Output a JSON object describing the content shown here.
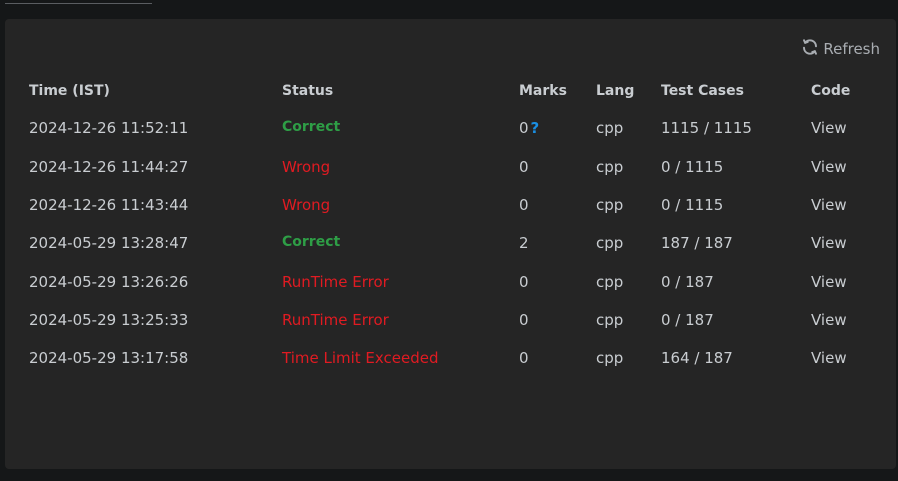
{
  "refresh_label": "Refresh",
  "headers": {
    "time": "Time (IST)",
    "status": "Status",
    "marks": "Marks",
    "lang": "Lang",
    "test_cases": "Test Cases",
    "code": "Code"
  },
  "rows": [
    {
      "time": "2024-12-26 11:52:11",
      "status": "Correct",
      "status_type": "correct",
      "marks": "0",
      "has_help": true,
      "lang": "cpp",
      "test_cases": "1115 / 1115",
      "code": "View"
    },
    {
      "time": "2024-12-26 11:44:27",
      "status": "Wrong",
      "status_type": "wrong",
      "marks": "0",
      "has_help": false,
      "lang": "cpp",
      "test_cases": "0 / 1115",
      "code": "View"
    },
    {
      "time": "2024-12-26 11:43:44",
      "status": "Wrong",
      "status_type": "wrong",
      "marks": "0",
      "has_help": false,
      "lang": "cpp",
      "test_cases": "0 / 1115",
      "code": "View"
    },
    {
      "time": "2024-05-29 13:28:47",
      "status": "Correct",
      "status_type": "correct",
      "marks": "2",
      "has_help": false,
      "lang": "cpp",
      "test_cases": "187 / 187",
      "code": "View"
    },
    {
      "time": "2024-05-29 13:26:26",
      "status": "RunTime Error",
      "status_type": "wrong",
      "marks": "0",
      "has_help": false,
      "lang": "cpp",
      "test_cases": "0 / 187",
      "code": "View"
    },
    {
      "time": "2024-05-29 13:25:33",
      "status": "RunTime Error",
      "status_type": "wrong",
      "marks": "0",
      "has_help": false,
      "lang": "cpp",
      "test_cases": "0 / 187",
      "code": "View"
    },
    {
      "time": "2024-05-29 13:17:58",
      "status": "Time Limit Exceeded",
      "status_type": "wrong",
      "marks": "0",
      "has_help": false,
      "lang": "cpp",
      "test_cases": "164 / 187",
      "code": "View"
    }
  ],
  "help_mark": "?",
  "colors": {
    "correct": "#2e9e46",
    "wrong": "#e01b22",
    "help": "#1a8fe3"
  }
}
